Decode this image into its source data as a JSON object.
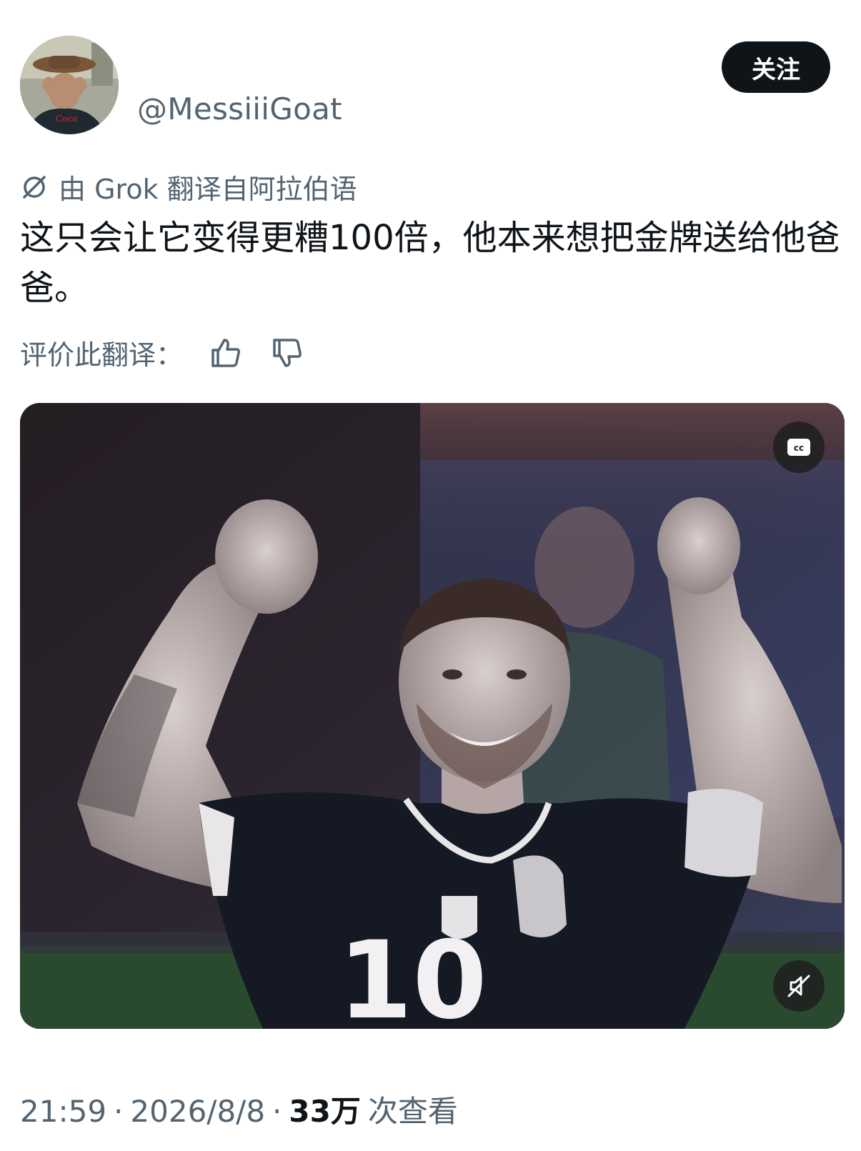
{
  "author": {
    "handle": "@MessiiiGoat",
    "avatar_icon": "avatar-photo"
  },
  "follow": {
    "label": "关注"
  },
  "translation": {
    "icon": "translate-icon",
    "source_label": "由 Grok 翻译自阿拉伯语",
    "text": "这只会让它变得更糟100倍，他本来想把金牌送给他爸爸。",
    "rate_label": "评价此翻译：",
    "thumbs_up_icon": "thumbs-up-icon",
    "thumbs_down_icon": "thumbs-down-icon"
  },
  "media": {
    "cc_icon": "cc-icon",
    "mute_icon": "muted-speaker-icon",
    "jersey_number": "10"
  },
  "meta": {
    "time": "21:59",
    "sep1": "·",
    "date": "2026/8/8",
    "sep2": "·",
    "views_count": "33万",
    "views_label": "次查看"
  },
  "colors": {
    "text_primary": "#0f1419",
    "text_secondary": "#536471",
    "button_bg": "#0f1419"
  }
}
